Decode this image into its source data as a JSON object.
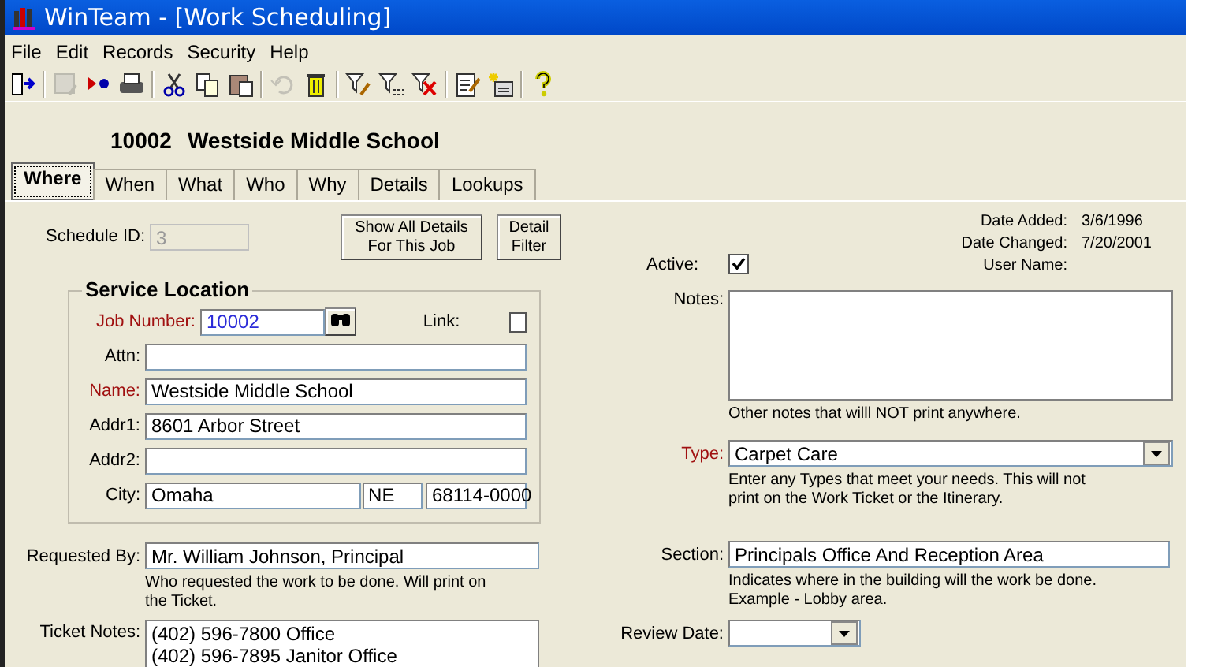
{
  "window": {
    "title": "WinTeam - [Work Scheduling]"
  },
  "menu": [
    {
      "label": "File"
    },
    {
      "label": "Edit"
    },
    {
      "label": "Records"
    },
    {
      "label": "Security"
    },
    {
      "label": "Help"
    }
  ],
  "toolbar": [
    {
      "kind": "exit",
      "disabled": false
    },
    {
      "kind": "sep"
    },
    {
      "kind": "save",
      "disabled": true
    },
    {
      "kind": "jump",
      "disabled": false
    },
    {
      "kind": "print",
      "disabled": false
    },
    {
      "kind": "sep"
    },
    {
      "kind": "cut",
      "disabled": false
    },
    {
      "kind": "copy",
      "disabled": false
    },
    {
      "kind": "paste",
      "disabled": false
    },
    {
      "kind": "sep"
    },
    {
      "kind": "undo",
      "disabled": true
    },
    {
      "kind": "delete",
      "disabled": false
    },
    {
      "kind": "sep"
    },
    {
      "kind": "filter_edit",
      "disabled": false
    },
    {
      "kind": "filter_list",
      "disabled": false
    },
    {
      "kind": "filter_clear",
      "disabled": false
    },
    {
      "kind": "sep"
    },
    {
      "kind": "notes",
      "disabled": false
    },
    {
      "kind": "new_record",
      "disabled": false
    },
    {
      "kind": "sep"
    },
    {
      "kind": "help",
      "disabled": false
    }
  ],
  "record": {
    "number": "10002",
    "name": "Westside Middle School"
  },
  "tabs": [
    {
      "label": "Where",
      "selected": true
    },
    {
      "label": "When",
      "selected": false
    },
    {
      "label": "What",
      "selected": false
    },
    {
      "label": "Who",
      "selected": false
    },
    {
      "label": "Why",
      "selected": false
    },
    {
      "label": "Details",
      "selected": false
    },
    {
      "label": "Lookups",
      "selected": false
    }
  ],
  "schedule_id": {
    "label": "Schedule ID:",
    "value": "3",
    "disabled": true
  },
  "buttons": [
    {
      "label": "Show All Details For This Job"
    },
    {
      "label": "Detail Filter"
    }
  ],
  "service_location": {
    "title": "Service Location",
    "job_number": {
      "label": "Job Number:",
      "value": "10002",
      "required": true
    },
    "link": {
      "label": "Link:",
      "checked": false
    },
    "fields": [
      {
        "label": "Attn:",
        "required": false
      },
      {
        "label": "Name:",
        "value": "Westside Middle School",
        "required": true
      },
      {
        "label": "Addr1:",
        "value": "8601 Arbor Street",
        "required": false
      },
      {
        "label": "Addr2:",
        "required": false
      }
    ],
    "city": {
      "label": "City:",
      "value": "Omaha",
      "state": "NE",
      "zip": "68114-0000"
    }
  },
  "requested_by": {
    "label": "Requested By:",
    "value": "Mr. William Johnson, Principal",
    "hint": "Who requested the work to be done.  Will print on the Ticket."
  },
  "ticket_notes": {
    "label": "Ticket Notes:",
    "lines": [
      "(402) 596-7800 Office",
      "(402) 596-7895 Janitor Office"
    ]
  },
  "active": {
    "label": "Active:",
    "checked": true
  },
  "audit": [
    {
      "label": "Date Added:",
      "value": "3/6/1996"
    },
    {
      "label": "Date Changed:",
      "value": "7/20/2001"
    },
    {
      "label": "User Name:"
    }
  ],
  "notes": {
    "label": "Notes:",
    "hint": "Other notes that willl NOT print anywhere."
  },
  "type": {
    "label": "Type:",
    "value": "Carpet Care",
    "required": true,
    "hint": "Enter any Types that meet your needs.  This will not print on the Work Ticket or the Itinerary."
  },
  "section": {
    "label": "Section:",
    "value": "Principals Office And Reception Area",
    "hint": "Indicates where in the building will the work be done.  Example - Lobby area."
  },
  "review_date": {
    "label": "Review Date:"
  }
}
